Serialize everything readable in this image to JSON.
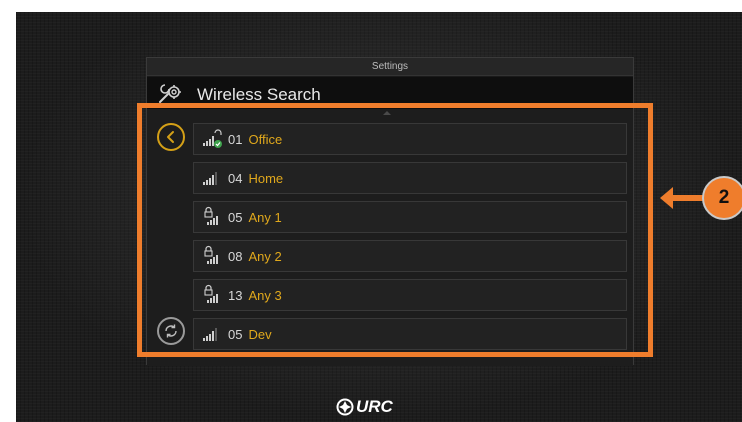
{
  "panel": {
    "title": "Settings",
    "header_title": "Wireless Search"
  },
  "networks": [
    {
      "channel": "01",
      "ssid": "Office",
      "locked": false,
      "connected": true
    },
    {
      "channel": "04",
      "ssid": "Home",
      "locked": false,
      "connected": false
    },
    {
      "channel": "05",
      "ssid": "Any 1",
      "locked": true,
      "connected": false
    },
    {
      "channel": "08",
      "ssid": "Any 2",
      "locked": true,
      "connected": false
    },
    {
      "channel": "13",
      "ssid": "Any 3",
      "locked": true,
      "connected": false
    },
    {
      "channel": "05",
      "ssid": "Dev",
      "locked": false,
      "connected": false
    }
  ],
  "icons": {
    "header": "tools-icon",
    "back": "chevron-left-icon",
    "refresh": "refresh-icon",
    "signal": "signal-bars-icon",
    "lock": "lock-icon",
    "connected": "check-icon"
  },
  "callout": {
    "number": "2"
  },
  "brand": {
    "wordmark": "URC"
  },
  "colors": {
    "accent": "#e0a81c",
    "annotation": "#ef7d2c",
    "connected": "#3fa34d"
  }
}
